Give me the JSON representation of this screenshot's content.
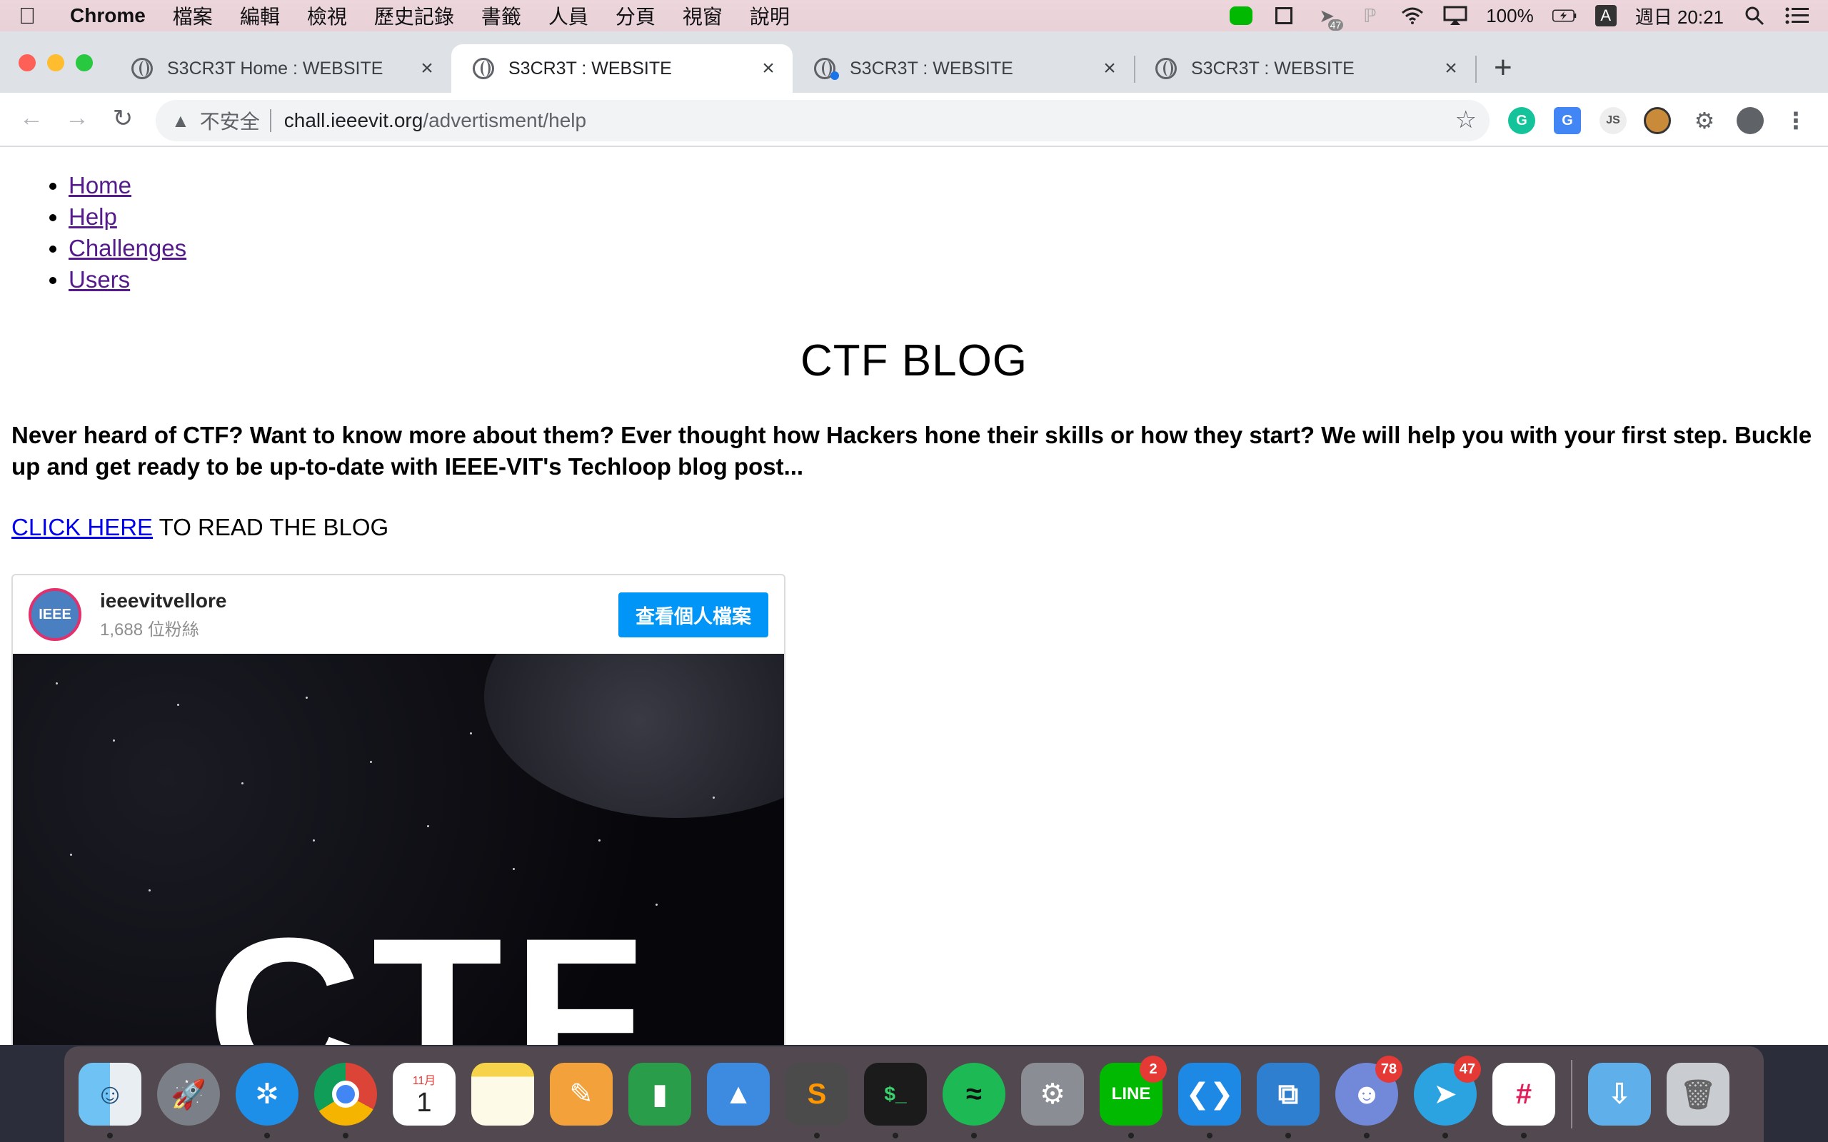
{
  "menubar": {
    "app_name": "Chrome",
    "items": [
      "檔案",
      "編輯",
      "檢視",
      "歷史記錄",
      "書籤",
      "人員",
      "分頁",
      "視窗",
      "說明"
    ],
    "battery": "100%",
    "input_method": "A",
    "clock": "週日 20:21",
    "tray_badge": "47"
  },
  "tabs": [
    {
      "title": "S3CR3T Home : WEBSITE"
    },
    {
      "title": "S3CR3T : WEBSITE"
    },
    {
      "title": "S3CR3T : WEBSITE"
    },
    {
      "title": "S3CR3T : WEBSITE"
    }
  ],
  "omnibox": {
    "security": "不安全",
    "host": "chall.ieeevit.org",
    "path": "/advertisment/help"
  },
  "page": {
    "nav": [
      "Home",
      "Help",
      "Challenges",
      "Users"
    ],
    "title": "CTF BLOG",
    "intro": "Never heard of CTF? Want to know more about them? Ever thought how Hackers hone their skills or how they start? We will help you with your first step. Buckle up and get ready to be up-to-date with IEEE-VIT's Techloop blog post...",
    "cta_link": "CLICK HERE",
    "cta_rest": " TO READ THE BLOG"
  },
  "embed": {
    "avatar_text": "IEEE",
    "username": "ieeevitvellore",
    "followers": "1,688 位粉絲",
    "view_button": "查看個人檔案",
    "image_text": "CTF"
  },
  "dock": {
    "apps": [
      {
        "name": "finder"
      },
      {
        "name": "launchpad"
      },
      {
        "name": "safari"
      },
      {
        "name": "chrome"
      },
      {
        "name": "calendar",
        "label": "1",
        "month": "11月"
      },
      {
        "name": "notes"
      },
      {
        "name": "pages"
      },
      {
        "name": "numbers"
      },
      {
        "name": "keynote"
      },
      {
        "name": "sublime-text"
      },
      {
        "name": "terminal"
      },
      {
        "name": "spotify"
      },
      {
        "name": "system-preferences"
      },
      {
        "name": "line",
        "badge": "2",
        "label": "LINE"
      },
      {
        "name": "vscode"
      },
      {
        "name": "vmware-fusion"
      },
      {
        "name": "discord",
        "badge": "78"
      },
      {
        "name": "telegram",
        "badge": "47"
      },
      {
        "name": "slack"
      },
      {
        "name": "downloads"
      },
      {
        "name": "trash"
      }
    ]
  }
}
